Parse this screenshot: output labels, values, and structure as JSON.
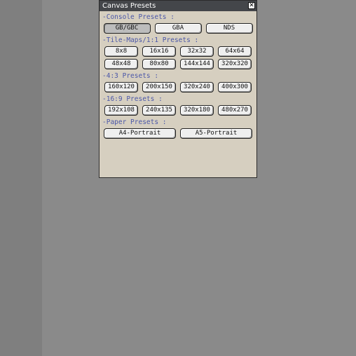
{
  "window": {
    "title": "Canvas Presets"
  },
  "sections": [
    {
      "label": "-Console Presets :",
      "buttons": [
        "GB/GBC",
        "GBA",
        "NDS"
      ]
    },
    {
      "label": "-Tile-Maps/1:1 Presets :",
      "rows": [
        [
          "8x8",
          "16x16",
          "32x32",
          "64x64"
        ],
        [
          "48x48",
          "80x80",
          "144x144",
          "320x320"
        ]
      ]
    },
    {
      "label": "-4:3 Presets :",
      "buttons": [
        "160x120",
        "200x150",
        "320x240",
        "400x300"
      ]
    },
    {
      "label": "-16:9 Presets :",
      "buttons": [
        "192x108",
        "240x135",
        "320x180",
        "480x270"
      ]
    },
    {
      "label": "-Paper Presets :",
      "buttons": [
        "A4-Portrait",
        "A5-Portrait"
      ]
    }
  ],
  "selected": "GB/GBC"
}
